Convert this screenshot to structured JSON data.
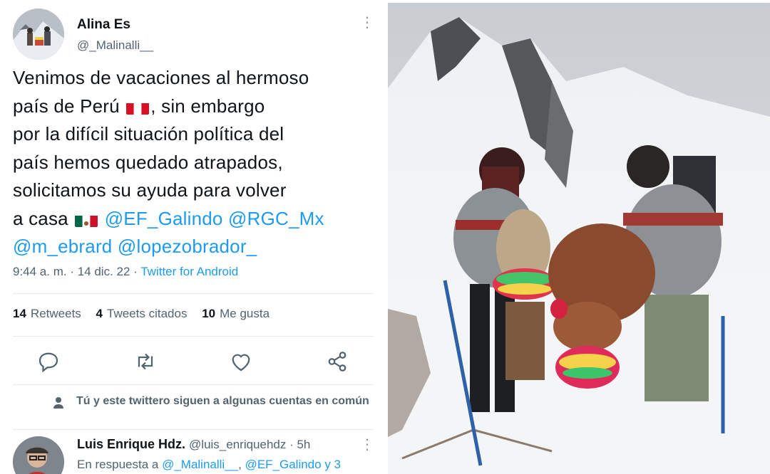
{
  "tweet": {
    "author_name": "Alina Es",
    "author_handle": "@_Malinalli__",
    "text_lines": [
      {
        "a": "Venimos de vacaciones al hermoso"
      },
      {
        "a": "país de Perú",
        "b": ", sin embargo"
      },
      {
        "a": "por la difícil situación política del"
      },
      {
        "a": "país hemos quedado atrapados,"
      },
      {
        "a": "solicitamos su ayuda para volver"
      },
      {
        "a": "a casa",
        "m1": "@EF_Galindo",
        "m2": "@RGC_Mx"
      },
      {
        "m1": "@m_ebrard",
        "m2": "@lopezobrador_"
      }
    ],
    "time": "9:44 a. m. · 14 dic. 22 · ",
    "source": "Twitter for Android",
    "stats": {
      "retweets_count": "14",
      "retweets_label": "Retweets",
      "quotes_count": "4",
      "quotes_label": "Tweets citados",
      "likes_count": "10",
      "likes_label": "Me gusta"
    }
  },
  "common_follow": "Tú y este twittero siguen a algunas cuentas en común",
  "reply": {
    "name": "Luis Enrique Hdz.",
    "handle_time": "@luis_enriquehdz · 5h",
    "reply_to_prefix": "En respuesta a ",
    "reply_to_m1": "@_Malinalli__",
    "reply_to_sep": ", ",
    "reply_to_m2": "@EF_Galindo",
    "reply_to_suffix": " y 3"
  },
  "colors": {
    "accent": "#1d9bf0",
    "secondary_text": "#536471"
  },
  "icons": [
    "more-icon",
    "reply-icon",
    "retweet-icon",
    "like-icon",
    "share-icon",
    "person-icon",
    "peru-flag-icon",
    "mexico-flag-icon"
  ]
}
